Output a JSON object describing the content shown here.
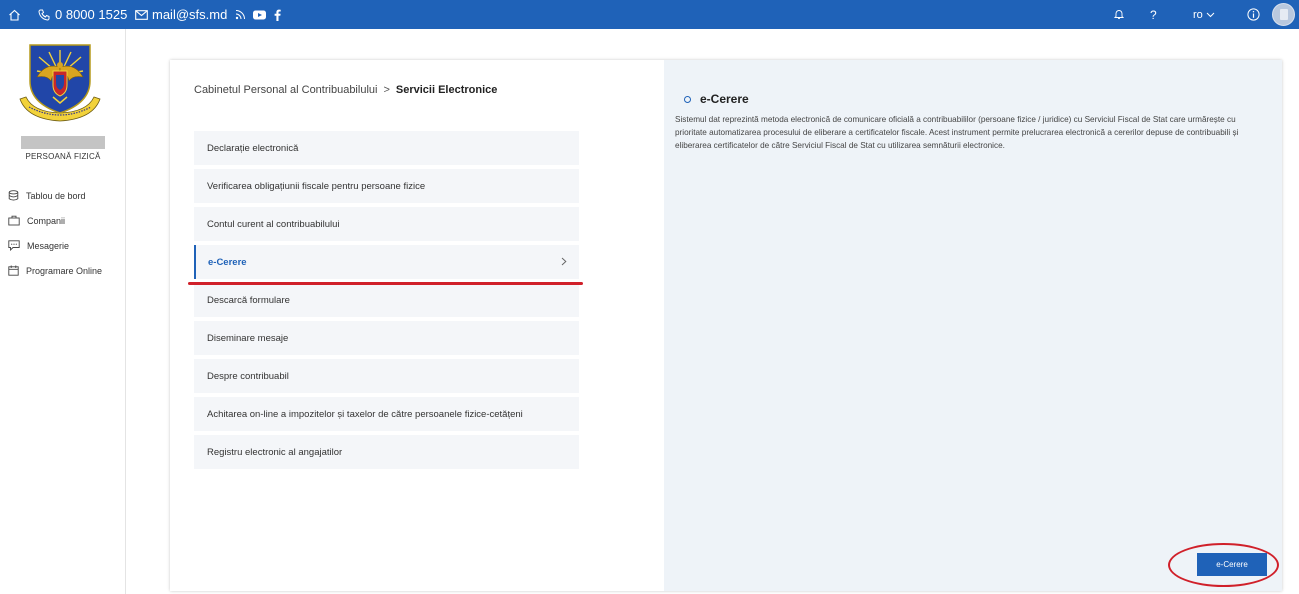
{
  "topbar": {
    "phone": "0 8000 1525",
    "email": "mail@sfs.md",
    "language": "ro",
    "icons": [
      "home-icon",
      "phone-icon",
      "mail-icon",
      "rss-icon",
      "youtube-icon",
      "facebook-icon",
      "bell-icon",
      "help-icon",
      "chevron-down-icon",
      "info-icon"
    ],
    "color": "#1f62b8"
  },
  "sidebar": {
    "user_role": "PERSOANĂ FIZICĂ",
    "items": [
      {
        "label": "Tablou de bord",
        "icon": "database-icon"
      },
      {
        "label": "Companii",
        "icon": "briefcase-icon"
      },
      {
        "label": "Mesagerie",
        "icon": "chat-icon"
      },
      {
        "label": "Programare Online",
        "icon": "calendar-icon"
      }
    ]
  },
  "breadcrumb": {
    "parent": "Cabinetul Personal al Contribuabilului",
    "separator": ">",
    "current": "Servicii Electronice"
  },
  "services": [
    {
      "label": "Declarație electronică",
      "active": false
    },
    {
      "label": "Verificarea obligațiunii fiscale pentru persoane fizice",
      "active": false
    },
    {
      "label": "Contul curent al contribuabilului",
      "active": false
    },
    {
      "label": "e-Cerere",
      "active": true
    },
    {
      "label": "Descarcă formulare",
      "active": false
    },
    {
      "label": "Diseminare mesaje",
      "active": false
    },
    {
      "label": "Despre contribuabil",
      "active": false
    },
    {
      "label": "Achitarea on-line a impozitelor și taxelor de către persoanele fizice-cetățeni",
      "active": false
    },
    {
      "label": "Registru electronic al angajatilor",
      "active": false
    }
  ],
  "detail": {
    "title": "e-Cerere",
    "text": "Sistemul dat reprezintă metoda electronică de comunicare oficială a contribuabililor (persoane fizice / juridice) cu Serviciul Fiscal de Stat care urmărește cu prioritate automatizarea procesului de eliberare a certificatelor fiscale. Acest instrument permite prelucrarea electronică a cererilor depuse de contribuabili și eliberarea certificatelor de către Serviciul Fiscal de Stat cu utilizarea semnăturii electronice.",
    "button_label": "e-Cerere"
  },
  "colors": {
    "accent": "#1f62b8",
    "annotation_red": "#d0202a",
    "panel_bg": "#eef3f8"
  }
}
